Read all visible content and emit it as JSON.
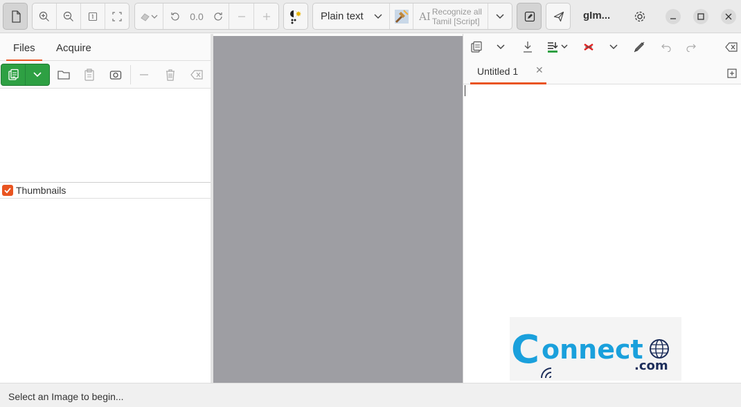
{
  "header": {
    "app_title": "gIm...",
    "zoom_value": "0.0",
    "output_mode": "Plain text",
    "recognize_label_line1": "Recognize all",
    "recognize_label_line2": "Tamil [Script]"
  },
  "left_panel": {
    "tabs": [
      {
        "label": "Files",
        "active": true
      },
      {
        "label": "Acquire",
        "active": false
      }
    ],
    "thumbnails_label": "Thumbnails",
    "thumbnails_checked": true
  },
  "right_panel": {
    "document_tab": "Untitled 1"
  },
  "status": {
    "message": "Select an Image to begin..."
  },
  "watermark": {
    "brand_main": "onnect",
    "brand_c": "C",
    "brand_suffix": ".com"
  },
  "colors": {
    "accent": "#e95420",
    "green": "#2ea043",
    "image_bg": "#9e9ea3",
    "watermark_blue": "#1aa0dc",
    "watermark_navy": "#1c2d5a"
  },
  "icons": [
    "new-document-icon",
    "zoom-in-icon",
    "zoom-out-icon",
    "zoom-original-icon",
    "zoom-fit-icon",
    "rotate-left-icon",
    "rotate-right-icon",
    "minus-icon",
    "plus-icon",
    "ocr-engine-icon",
    "chevron-down-icon",
    "image-adjust-icon",
    "edit-icon",
    "send-icon",
    "gear-icon",
    "minimize-icon",
    "maximize-icon",
    "close-icon",
    "open-folder-icon",
    "clipboard-icon",
    "camera-icon",
    "trash-icon",
    "clear-icon",
    "copy-icon",
    "save-icon",
    "insert-icon",
    "erase-icon",
    "spellcheck-icon",
    "undo-icon",
    "redo-icon",
    "clear-text-icon",
    "new-tab-icon"
  ]
}
